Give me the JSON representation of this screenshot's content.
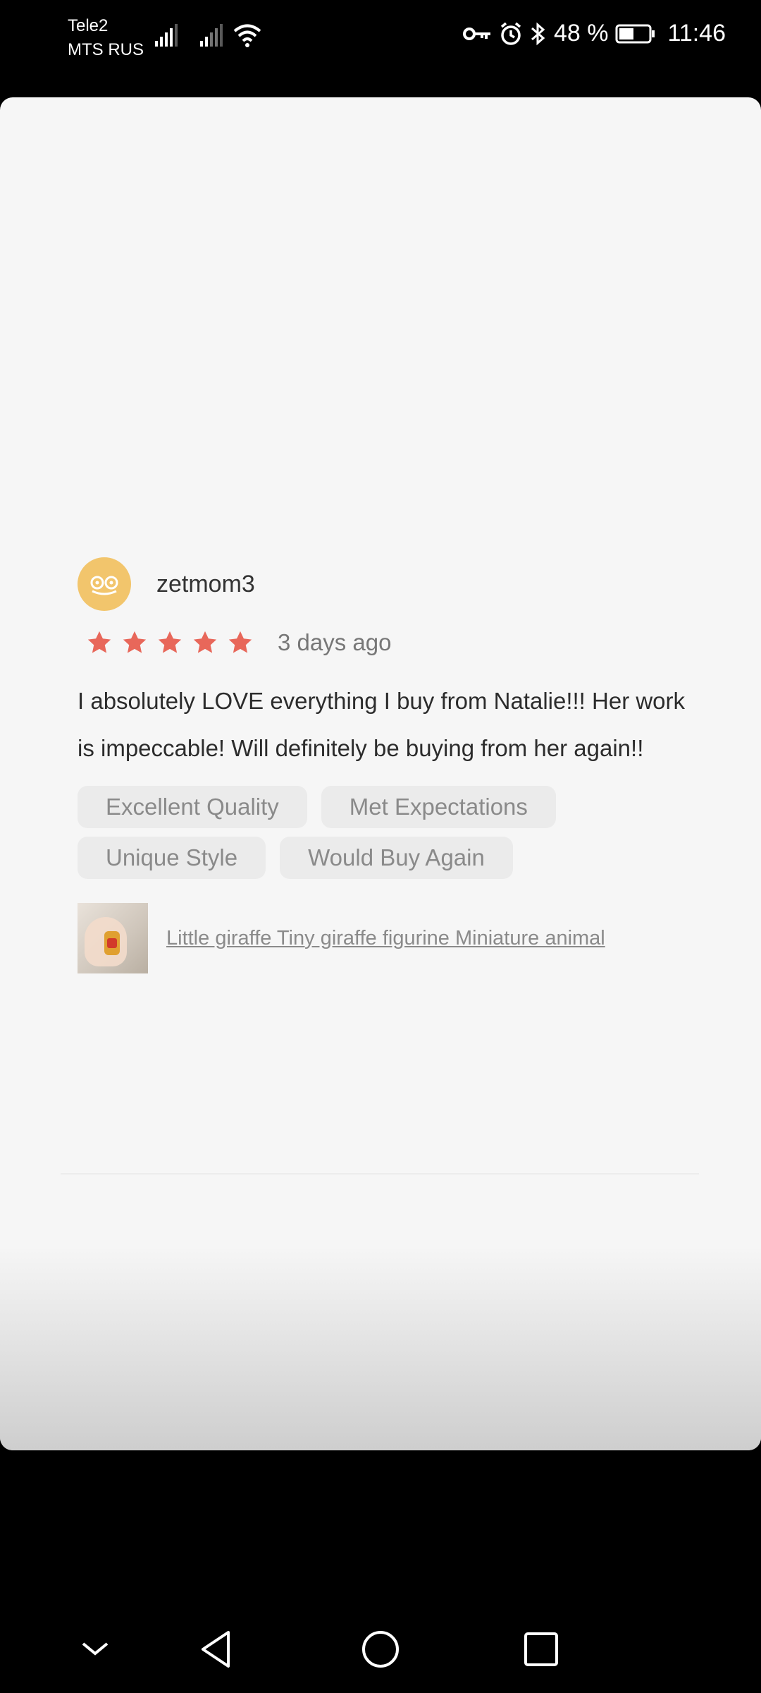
{
  "status_bar": {
    "carrier1": "Tele2",
    "carrier2": "MTS RUS",
    "battery": "48 %",
    "time": "11:46"
  },
  "review": {
    "username": "zetmom3",
    "rating": 5,
    "rating_max": 5,
    "date": "3 days ago",
    "text": "I absolutely LOVE  everything I buy from Natalie!!! Her work is impeccable! Will definitely be buying from her again!!",
    "tags": [
      "Excellent Quality",
      "Met Expectations",
      "Unique Style",
      "Would Buy Again"
    ],
    "product_title": "Little giraffe Tiny giraffe figurine Miniature animal"
  },
  "colors": {
    "star": "#e8675a",
    "avatar": "#f2c56c",
    "sheet": "#f6f6f6"
  },
  "nav": {
    "icons": [
      "chevron-down-icon",
      "back-icon",
      "home-icon",
      "recents-icon"
    ]
  }
}
